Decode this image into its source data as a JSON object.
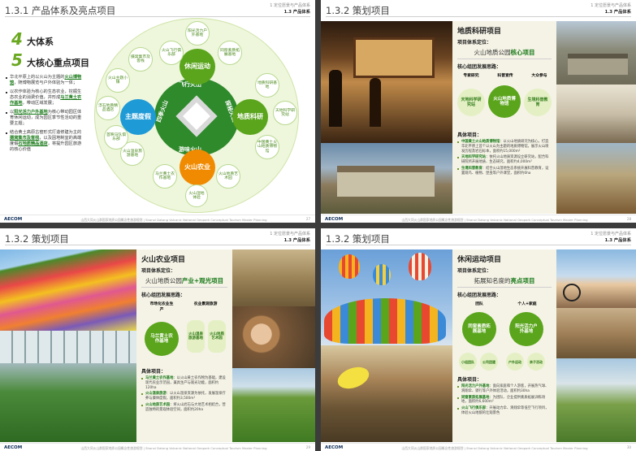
{
  "pages": [
    {
      "section": "1.3.1 产品体系及亮点项目",
      "hdr1": "1 定位愿景与产品体系",
      "hdr2": "1.3 产品体系",
      "page_no": "27"
    },
    {
      "section": "1.3.2 策划项目",
      "hdr1": "1 定位愿景与产品体系",
      "hdr2": "1.3 产品体系",
      "page_no": "28"
    },
    {
      "section": "1.3.2 策划项目",
      "hdr1": "1 定位愿景与产品体系",
      "hdr2": "1.3 产品体系",
      "page_no": "29"
    },
    {
      "section": "1.3.2 策划项目",
      "hdr1": "1 定位愿景与产品体系",
      "hdr2": "1.3 产品体系",
      "page_no": "30"
    }
  ],
  "footer": {
    "logo": "AECOM",
    "text": "山西大同火山群国家地质公园概念性旅游规划 | Shanxi Datong Volcanic National Geopark Conceptual Tourism Master Planning"
  },
  "p1": {
    "num1": "4",
    "big1": "大体系",
    "num2": "5",
    "big2": "大核心重点项目",
    "bullets": [
      {
        "a": "华北平原上的以火山为主题的",
        "h": "火山博物馆",
        "b": "，随博物展览与户外体验为一体；"
      },
      {
        "a": "以农作体验为核心的生态农业，挖掘生态农业的消费价值，并形成",
        "h": "马兰黄土农作基地",
        "b": "，带动区域发展；"
      },
      {
        "a": "以",
        "h": "阳光活力户外基地",
        "b": "为核心带动园区体育休闲运动，成为园区季节性活动的重要主题；"
      },
      {
        "a": "结合黄土高原古窑形式打造修建为主的",
        "h": "摄窝集市及客栈",
        "b": "，以及因地制宜的高端度假",
        "h2": "石地质精品酒店",
        "b2": "，将提升园区旅游的核心价值"
      }
    ],
    "core": [
      "休闲运动",
      "地质科研",
      "火山农业",
      "主题度假"
    ],
    "ring": [
      "飞行火山",
      "探秘火山",
      "游味火山",
      "四季火山"
    ],
    "outer": [
      "阳光活力户外基地",
      "火山飞行俱乐部",
      "同窗素质拓展基地",
      "地质科研基地",
      "天地科学研究站",
      "中国黄土火山地质博物馆",
      "火山地质艺术园",
      "火山湿地体验",
      "马兰黄土农作基地",
      "火山温泉旅游基地",
      "首映马队俱乐部",
      "浮石地质精品酒店",
      "火山主题小镇",
      "摄窝集市及客栈"
    ]
  },
  "p2": {
    "title": "地质科研项目",
    "pos_label": "项目体系定位：",
    "pos_a": "火山地质公园",
    "pos_h": "核心项目",
    "core_label": "核心组团发展思路：",
    "chips": [
      "专家研究",
      "科普宣传",
      "大众参与"
    ],
    "nodes": [
      "天地科学研究站",
      "火山地质博物馆",
      "生境科普教育"
    ],
    "details_label": "具体项目：",
    "items": [
      {
        "h": "中国黄土火山地质博物馆",
        "t": "：以火山地质研究为核心，打造华北平原上首个以火山为主题的地质博物馆，展示火山喷发历程及岩石标本，面积约15,000m²"
      },
      {
        "h": "天地科学研究站",
        "t": "：依托火山地质资源设立研究站，配合科研院所开展地质、生态研究，面积约4,000m²"
      },
      {
        "h": "生境科普教育",
        "t": "：结合火山湿地生态系统开展科普教育，设置观鸟、植物、昆虫等户外课堂，面积约6ha"
      }
    ]
  },
  "p3": {
    "title": "火山农业项目",
    "pos_label": "项目体系定位：",
    "pos_a": "火山地质公园",
    "pos_h": "产业+观光项目",
    "core_label": "核心组团发展思路：",
    "chips": [
      "市场化农业生产",
      "农业景观旅游"
    ],
    "nodes": [
      "马兰黄土农作基地",
      "火山温泉旅游基地",
      "火山地质艺术园"
    ],
    "details_label": "具体项目：",
    "items": [
      {
        "h": "马兰黄土农作基地",
        "t": "：以火山黄土农作物为基础，建设现代农业示范园，兼具生产与观光功能，面积约120ha"
      },
      {
        "h": "火山温泉旅游",
        "t": "：以火山温泉资源为依托，发展温泉疗养与康体度假，面积约3,500m²"
      },
      {
        "h": "火山地质艺术园",
        "t": "：将火山岩石与大地艺术相结合，营造独特的景观体验空间，面积约20ha"
      }
    ]
  },
  "p4": {
    "title": "休闲运动项目",
    "pos_label": "项目体系定位：",
    "pos_a": "拓展知名度的",
    "pos_h": "亮点项目",
    "core_label": "核心组团发展思路：",
    "chips": [
      "团队",
      "个人+家庭"
    ],
    "nodes": [
      "同窗素质拓展基地",
      "阳光活力户外基地"
    ],
    "subs": [
      "小组团队",
      "公司团建",
      "户外运动",
      "亲子活动"
    ],
    "details_label": "具体项目：",
    "items": [
      {
        "h": "阳光活力户外基地",
        "t": "：面向家庭和个人游客，开展热气球、滑翔伞、骑行等户外体验活动，面积约30ha"
      },
      {
        "h": "同窗素质拓展基地",
        "t": "：为团队、企业提供素质拓展训练场地，面积约6,600m²"
      },
      {
        "h": "火山飞行俱乐部",
        "t": "：开展动力伞、滑翔伞等低空飞行项目，体验火山地貌的壮观景色"
      }
    ]
  },
  "colors": {
    "green": "#5aa51c",
    "orange": "#f08a00",
    "blue": "#1e9ad6",
    "darkgreen": "#4a7a2a"
  }
}
